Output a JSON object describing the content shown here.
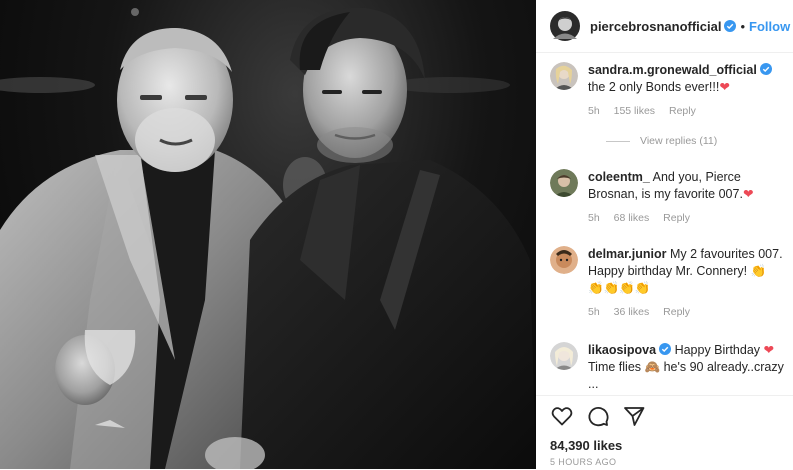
{
  "post": {
    "username": "piercebrosnanofficial",
    "follow_label": "Follow",
    "separator": "•",
    "likes": "84,390 likes",
    "timestamp": "5 HOURS AGO"
  },
  "comments": [
    {
      "username": "sandra.m.gronewald_official",
      "verified": true,
      "text": "the 2 only Bonds ever!!!",
      "emoji": "❤",
      "age": "5h",
      "likes": "155 likes",
      "reply": "Reply",
      "view_replies": "View replies (11)"
    },
    {
      "username": "coleentm_",
      "verified": false,
      "text": "And you, Pierce Brosnan, is my favorite 007.",
      "emoji": "❤",
      "age": "5h",
      "likes": "68 likes",
      "reply": "Reply"
    },
    {
      "username": "delmar.junior",
      "verified": false,
      "text": "My 2 favourites 007. Happy birthday Mr. Connery!",
      "emoji": "👏",
      "emoji_row": "👏👏👏👏",
      "age": "5h",
      "likes": "36 likes",
      "reply": "Reply"
    },
    {
      "username": "likaosipova",
      "verified": true,
      "text": "Happy Birthday",
      "emoji": "❤",
      "text2": "Time flies",
      "emoji2": "🙈",
      "text3": "he's 90 already..crazy ..."
    }
  ],
  "colors": {
    "link_blue": "#3897f0",
    "verified_blue": "#3897f0",
    "heart_red": "#ed4956",
    "meta_gray": "#999999"
  },
  "icons": [
    "heart-icon",
    "comment-icon",
    "share-icon",
    "verified-icon"
  ]
}
